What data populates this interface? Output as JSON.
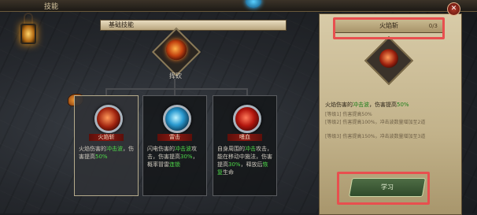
{
  "window": {
    "title": "技能"
  },
  "chain": {
    "header": "基础技能",
    "main_skill_label": "挥砍"
  },
  "cards": [
    {
      "name": "火焰斩",
      "desc_pre": "火焰伤害的",
      "desc_green": "冲击波",
      "desc_mid": "，伤害提高",
      "desc_green2": "50%"
    },
    {
      "name": "雷击",
      "desc_pre": "闪电伤害的",
      "desc_green": "冲击波",
      "desc_mid": "攻击，伤害提高",
      "desc_green2": "30%",
      "desc_tail": "，概率冒雷",
      "desc_green3": "连锁"
    },
    {
      "name": "嗜血",
      "desc_pre": "自身周围的",
      "desc_green": "冲击",
      "desc_mid": "攻击，能在移动中施法，伤害提高",
      "desc_green2": "30%",
      "desc_tail": "，释放后",
      "desc_green3": "恢复",
      "desc_tail2": "生命"
    }
  ],
  "panel": {
    "skill_name": "火焰斩",
    "progress": "0/3",
    "desc_pre": "火焰伤害的",
    "desc_green": "冲击波",
    "desc_mid": "，伤害提高",
    "desc_green2": "50%",
    "levels": [
      "[等级1] 伤害提高50%",
      "[等级2] 伤害提高100%，冲击波数量增加至2道",
      "[等级3] 伤害提高150%，冲击波数量增加至3道"
    ],
    "upgrade_label": "学习"
  },
  "colors": {
    "highlight": "#e84f4f",
    "green_text": "#4fd84a",
    "gem": "#37b7ff"
  }
}
